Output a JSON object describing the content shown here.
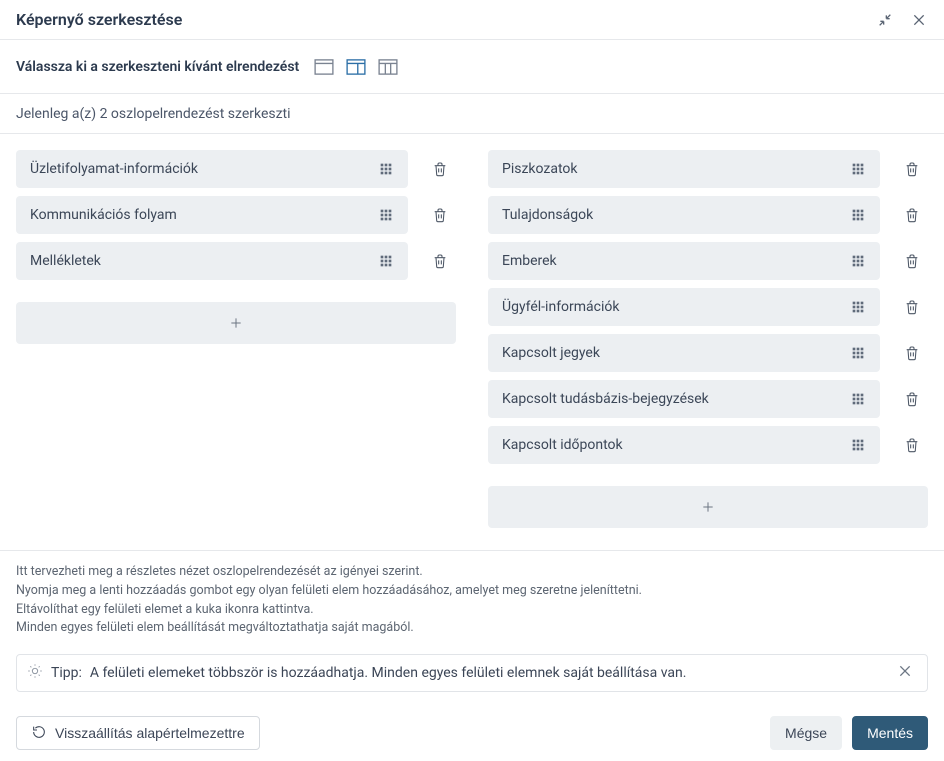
{
  "header": {
    "title": "Képernyő szerkesztése"
  },
  "layout_picker": {
    "label": "Válassza ki a szerkeszteni kívánt elrendezést"
  },
  "current_layout_text": "Jelenleg a(z) 2 oszlopelrendezést szerkeszti",
  "left_column": [
    {
      "label": "Üzletifolyamat-információk"
    },
    {
      "label": "Kommunikációs folyam"
    },
    {
      "label": "Mellékletek"
    }
  ],
  "right_column": [
    {
      "label": "Piszkozatok"
    },
    {
      "label": "Tulajdonságok"
    },
    {
      "label": "Emberek"
    },
    {
      "label": "Ügyfél-információk"
    },
    {
      "label": "Kapcsolt jegyek"
    },
    {
      "label": "Kapcsolt tudásbázis-bejegyzések"
    },
    {
      "label": "Kapcsolt időpontok"
    }
  ],
  "help": {
    "line1": "Itt tervezheti meg a részletes nézet oszlopelrendezését az igényei szerint.",
    "line2": "Nyomja meg a lenti hozzáadás gombot egy olyan felületi elem hozzáadásához, amelyet meg szeretne jeleníttetni.",
    "line3": "Eltávolíthat egy felületi elemet a kuka ikonra kattintva.",
    "line4": "Minden egyes felületi elem beállítását megváltoztathatja saját magából."
  },
  "tip": {
    "label": "Tipp:",
    "text": "A felületi elemeket többször is hozzáadhatja. Minden egyes felületi elemnek saját beállítása van."
  },
  "footer": {
    "reset": "Visszaállítás alapértelmezettre",
    "cancel": "Mégse",
    "save": "Mentés"
  }
}
